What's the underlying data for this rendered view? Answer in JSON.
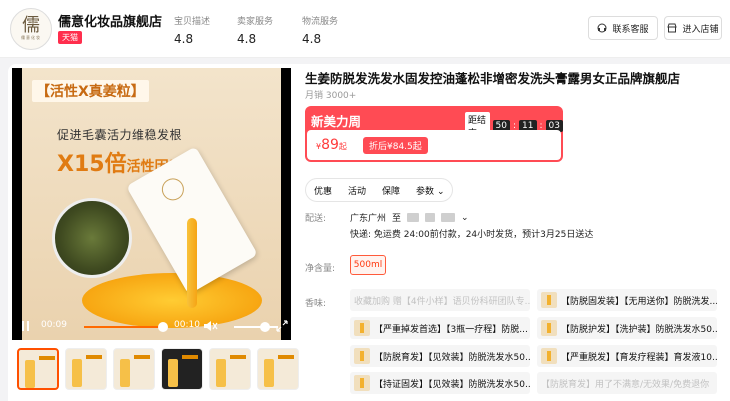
{
  "shop": {
    "logo_char": "儒",
    "logo_sub": "儒意化妆",
    "name": "儒意化妆品旗舰店",
    "badge": "天猫",
    "scores": [
      {
        "label": "宝贝描述",
        "value": "4.8"
      },
      {
        "label": "卖家服务",
        "value": "4.8"
      },
      {
        "label": "物流服务",
        "value": "4.8"
      }
    ],
    "contact_label": "联系客服",
    "enter_label": "进入店铺"
  },
  "media": {
    "poster_tag": "【活性X真姜粒】",
    "poster_line1": "促进毛囊活力维稳发根",
    "poster_line2": "X15倍",
    "poster_line2b": "活性因子",
    "time_current": "00:09",
    "time_total": "00:10",
    "progress": 0.9,
    "volume": 1.0
  },
  "product": {
    "title": "生姜防脱发洗发水固发控油蓬松非增密发洗头膏露男女正品牌旗舰店",
    "sales": "月销 3000+",
    "promo_title": "新美力周",
    "countdown_label": "距结束",
    "countdown": [
      "50",
      "11",
      "03"
    ],
    "price_symbol": "¥",
    "price": "89",
    "price_suffix": "起",
    "after_price": "折后¥84.5起",
    "tabs": [
      "优惠",
      "活动",
      "保障",
      "参数"
    ],
    "ship_label": "配送:",
    "ship_from": "广东广州",
    "ship_to": "至",
    "ship_info": "快递: 免运费  24:00前付款，24小时发货，预计3月25日送达",
    "volume_label": "净含量:",
    "volume_value": "500ml",
    "scent_label": "香味:",
    "options": [
      "收藏加购  赠【4件小样】语贝份科研团队专...",
      "【防脱固发装】【无用送你】防脱洗发...",
      "【严重掉发首选】【3瓶一疗程】防脱...",
      "【防脱护发】【洗护装】防脱洗发水50...",
      "【防脱育发】【见效装】防脱洗发水50...",
      "【严重脱发】【育发疗程装】育发液10...",
      "【持证固发】【见效装】防脱洗发水50...",
      "【防脱育发】用了不满意/无效果/免费退你"
    ]
  },
  "colors": {
    "accent": "#ff4b54",
    "orange": "#ff5000",
    "tmall": "#ff2e4d"
  }
}
